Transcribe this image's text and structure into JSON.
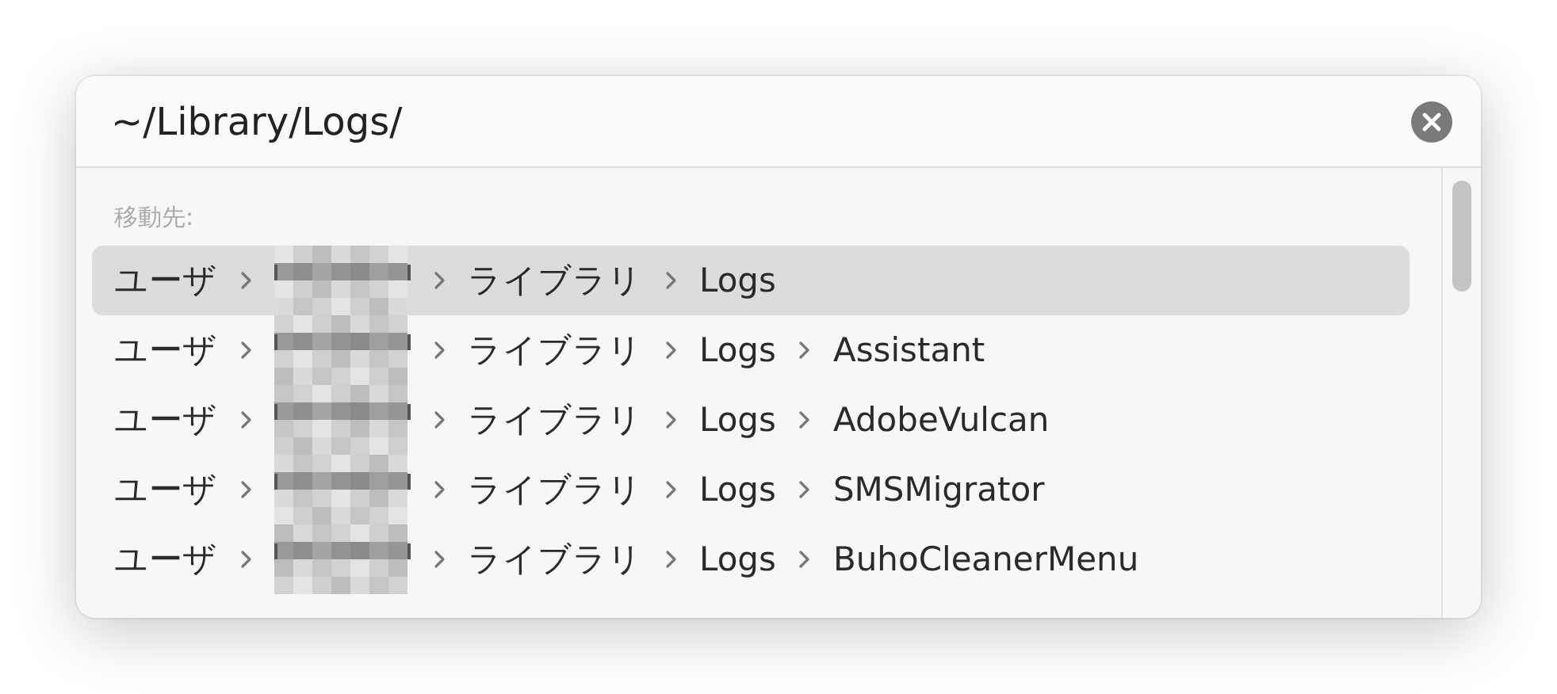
{
  "path_field": {
    "value": "~/Library/Logs/"
  },
  "results": {
    "label": "移動先:",
    "rows": [
      {
        "selected": true,
        "segments": [
          {
            "kind": "text",
            "text": "ユーザ"
          },
          {
            "kind": "redacted"
          },
          {
            "kind": "text",
            "text": "ライブラリ"
          },
          {
            "kind": "text",
            "text": "Logs"
          }
        ]
      },
      {
        "selected": false,
        "segments": [
          {
            "kind": "text",
            "text": "ユーザ"
          },
          {
            "kind": "redacted"
          },
          {
            "kind": "text",
            "text": "ライブラリ"
          },
          {
            "kind": "text",
            "text": "Logs"
          },
          {
            "kind": "text",
            "text": "Assistant"
          }
        ]
      },
      {
        "selected": false,
        "segments": [
          {
            "kind": "text",
            "text": "ユーザ"
          },
          {
            "kind": "redacted"
          },
          {
            "kind": "text",
            "text": "ライブラリ"
          },
          {
            "kind": "text",
            "text": "Logs"
          },
          {
            "kind": "text",
            "text": "AdobeVulcan"
          }
        ]
      },
      {
        "selected": false,
        "segments": [
          {
            "kind": "text",
            "text": "ユーザ"
          },
          {
            "kind": "redacted"
          },
          {
            "kind": "text",
            "text": "ライブラリ"
          },
          {
            "kind": "text",
            "text": "Logs"
          },
          {
            "kind": "text",
            "text": "SMSMigrator"
          }
        ]
      },
      {
        "selected": false,
        "segments": [
          {
            "kind": "text",
            "text": "ユーザ"
          },
          {
            "kind": "redacted"
          },
          {
            "kind": "text",
            "text": "ライブラリ"
          },
          {
            "kind": "text",
            "text": "Logs"
          },
          {
            "kind": "text",
            "text": "BuhoCleanerMenu"
          }
        ]
      }
    ]
  }
}
